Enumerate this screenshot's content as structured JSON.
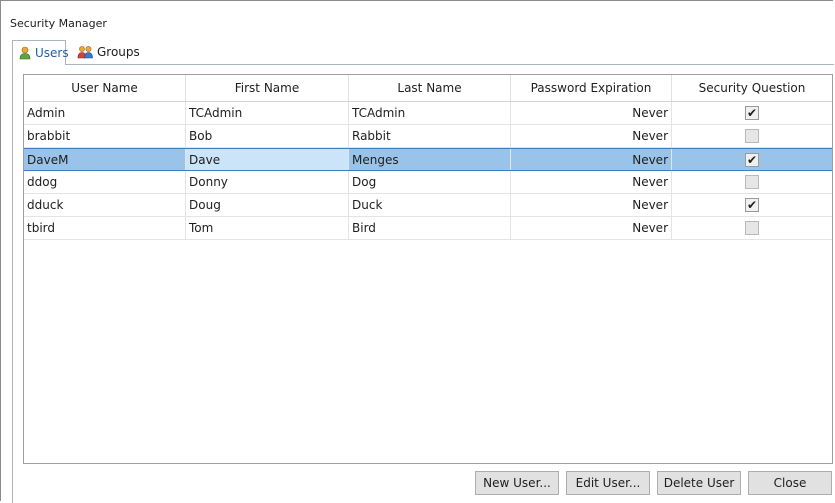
{
  "window": {
    "title": "Security Manager"
  },
  "tabs": [
    {
      "label": "Users",
      "icon": "user-icon"
    },
    {
      "label": "Groups",
      "icon": "group-icon"
    }
  ],
  "grid": {
    "columns": [
      "User Name",
      "First Name",
      "Last Name",
      "Password Expiration",
      "Security Question"
    ],
    "rows": [
      {
        "user": "Admin",
        "first": "TCAdmin",
        "last": "TCAdmin",
        "expiration": "Never",
        "security_question": true
      },
      {
        "user": "brabbit",
        "first": "Bob",
        "last": "Rabbit",
        "expiration": "Never",
        "security_question": false
      },
      {
        "user": "DaveM",
        "first": "Dave",
        "last": "Menges",
        "expiration": "Never",
        "security_question": true
      },
      {
        "user": "ddog",
        "first": "Donny",
        "last": "Dog",
        "expiration": "Never",
        "security_question": false
      },
      {
        "user": "dduck",
        "first": "Doug",
        "last": "Duck",
        "expiration": "Never",
        "security_question": true
      },
      {
        "user": "tbird",
        "first": "Tom",
        "last": "Bird",
        "expiration": "Never",
        "security_question": false
      }
    ],
    "selected_row": 2
  },
  "buttons": {
    "new_user": "New User...",
    "edit_user": "Edit User...",
    "delete_user": "Delete User",
    "close": "Close"
  },
  "colors": {
    "selection": "#99c3e8",
    "active_tab_text": "#1f5fa8"
  }
}
